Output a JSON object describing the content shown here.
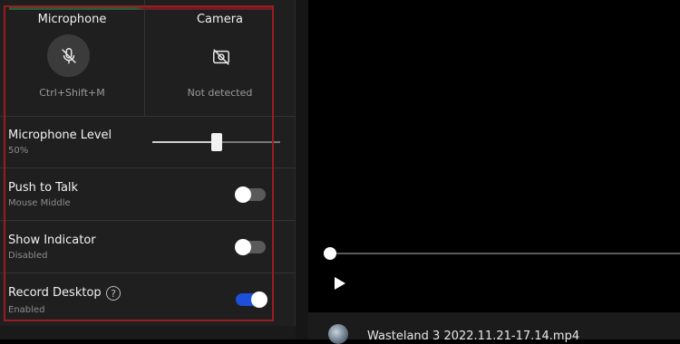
{
  "devices": {
    "microphone": {
      "title": "Microphone",
      "shortcut": "Ctrl+Shift+M",
      "icon": "microphone-muted-icon"
    },
    "camera": {
      "title": "Camera",
      "status": "Not detected",
      "icon": "camera-off-icon"
    }
  },
  "settings": {
    "mic_level": {
      "label": "Microphone Level",
      "value_text": "50%",
      "value": 0.5
    },
    "push_to_talk": {
      "label": "Push to Talk",
      "sub": "Mouse Middle",
      "enabled": false
    },
    "show_indicator": {
      "label": "Show Indicator",
      "sub": "Disabled",
      "enabled": false
    },
    "record_desktop": {
      "label": "Record Desktop",
      "sub": "Enabled",
      "enabled": true,
      "help_glyph": "?"
    }
  },
  "player": {
    "file_name": "Wasteland 3  2022.11.21-17.14.mp4",
    "progress": 0.0,
    "play_icon": "play-icon"
  },
  "colors": {
    "highlight_border": "#9a1c22",
    "toggle_on": "#1e4fd8",
    "panel_bg": "#1f1f1f"
  }
}
